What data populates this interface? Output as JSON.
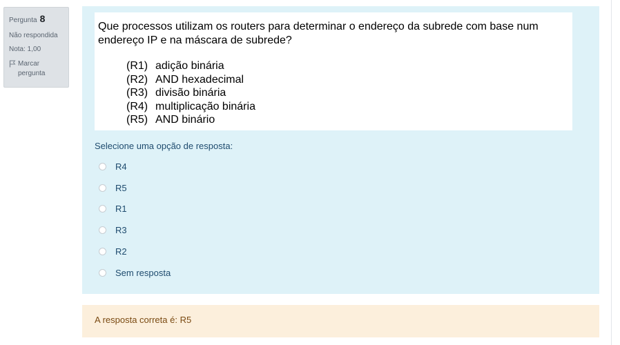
{
  "info": {
    "question_label": "Pergunta",
    "question_number": "8",
    "status": "Não respondida",
    "grade": "Nota: 1,00",
    "flag_label": "Marcar pergunta",
    "flag_icon": "flag-icon"
  },
  "question": {
    "text": "Que processos utilizam os routers para determinar o endereço da subrede com base num endereço IP e na máscara de subrede?",
    "items": [
      {
        "code": "(R1)",
        "text": "adição binária"
      },
      {
        "code": "(R2)",
        "text": "AND hexadecimal"
      },
      {
        "code": "(R3)",
        "text": "divisão binária"
      },
      {
        "code": "(R4)",
        "text": "multiplicação binária"
      },
      {
        "code": "(R5)",
        "text": "AND binário"
      }
    ]
  },
  "prompt": "Selecione uma opção de resposta:",
  "options": [
    "R4",
    "R5",
    "R1",
    "R3",
    "R2",
    "Sem resposta"
  ],
  "feedback": "A resposta correta é: R5",
  "colors": {
    "info_bg": "#dee2e6",
    "formulation_bg": "#def2f8",
    "outcome_bg": "#fcefdc",
    "text_blue": "#1e4b6e",
    "outcome_text": "#7a4a12"
  }
}
